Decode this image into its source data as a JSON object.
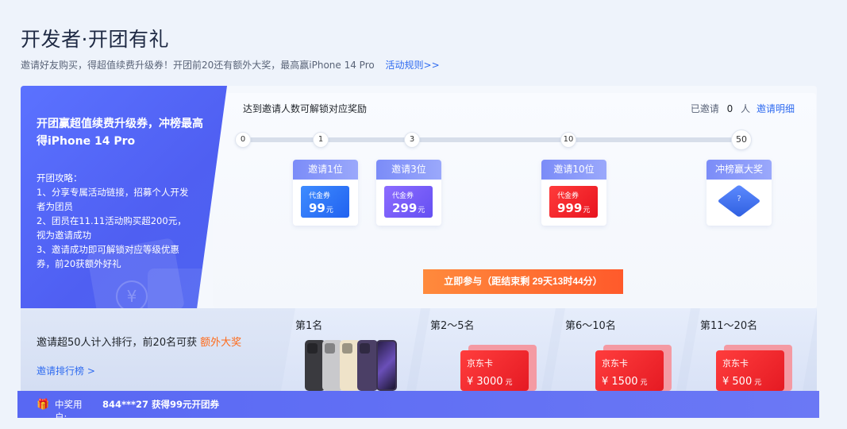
{
  "header": {
    "title": "开发者·开团有礼",
    "subtitle": "邀请好友购买，得超值续费升级券！开团前20还有额外大奖，最高赢iPhone 14 Pro",
    "rules_link": "活动规则>>"
  },
  "panel": {
    "headline": "开团赢超值续费升级券，冲榜最高得iPhone 14 Pro",
    "guide_title": "开团攻略：",
    "guide": [
      "1、分享专属活动链接，招募个人开发者为团员",
      "2、团员在11.11活动购买超200元，视为邀请成功",
      "3、邀请成功即可解锁对应等级优惠券，前20获额外好礼"
    ]
  },
  "progress": {
    "label": "达到邀请人数可解锁对应奖励",
    "invited_prefix": "已邀请",
    "invited_count": "0",
    "invited_suffix": "人",
    "detail_link": "邀请明细",
    "nodes": [
      "0",
      "1",
      "3",
      "10",
      "50"
    ]
  },
  "rewards": [
    {
      "title": "邀请1位",
      "type": "代金券",
      "amount": "99",
      "unit": "元",
      "color": "#2f6bf0"
    },
    {
      "title": "邀请3位",
      "type": "代金券",
      "amount": "299",
      "unit": "元",
      "color": "#6f5af5"
    },
    {
      "title": "邀请10位",
      "type": "代金券",
      "amount": "999",
      "unit": "元",
      "color": "#ee1f28"
    },
    {
      "title": "冲榜赢大奖",
      "icon": "mystery-box-icon"
    }
  ],
  "cta": {
    "label": "立即参与（距结束剩 29天13时44分）"
  },
  "ranking": {
    "intro": "邀请超50人计入排行，前20名可获",
    "intro_highlight": "额外大奖",
    "link": "邀请排行榜 >",
    "tiers": [
      {
        "title": "第1名",
        "prize": "iphone-14-pro-phones"
      },
      {
        "title": "第2～5名",
        "card_name": "京东卡",
        "amount": "¥ 3000",
        "unit": "元"
      },
      {
        "title": "第6～10名",
        "card_name": "京东卡",
        "amount": "¥ 1500",
        "unit": "元"
      },
      {
        "title": "第11～20名",
        "card_name": "京东卡",
        "amount": "¥ 500",
        "unit": "元"
      }
    ]
  },
  "winner_bar": {
    "label": "中奖用户:",
    "text": "844***27 获得99元开团券"
  },
  "colors": {
    "brand_blue": "#4f5ff2",
    "link": "#2f6bf0",
    "highlight": "#ff6a1a",
    "cta_start": "#ff8a3c",
    "cta_end": "#ff5a2b"
  }
}
